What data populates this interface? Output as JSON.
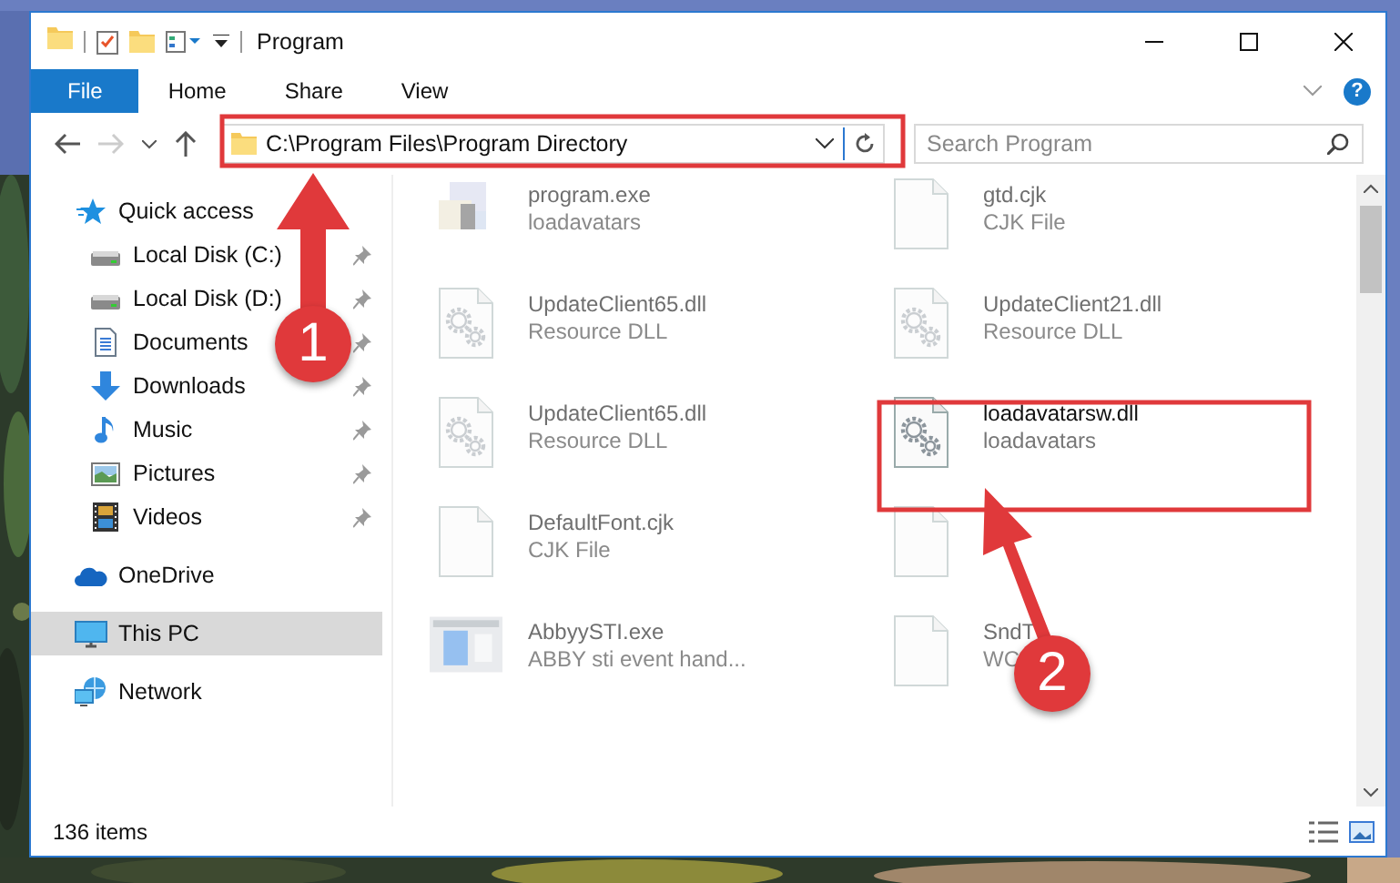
{
  "window": {
    "title": "Program"
  },
  "ribbon_tabs": [
    {
      "label": "File",
      "kind": "file"
    },
    {
      "label": "Home",
      "kind": "tab"
    },
    {
      "label": "Share",
      "kind": "tab"
    },
    {
      "label": "View",
      "kind": "tab"
    }
  ],
  "help": "?",
  "address": {
    "path": "C:\\Program Files\\Program Directory"
  },
  "search": {
    "placeholder": "Search Program"
  },
  "nav": [
    {
      "label": "Quick access",
      "kind": "star",
      "selected": false,
      "children": [
        {
          "label": "Local Disk (C:)",
          "kind": "drive",
          "pinned": true,
          "selected": false
        },
        {
          "label": "Local Disk (D:)",
          "kind": "drive",
          "pinned": true,
          "selected": false
        },
        {
          "label": "Documents",
          "kind": "documents",
          "pinned": true,
          "selected": false
        },
        {
          "label": "Downloads",
          "kind": "downloads",
          "pinned": true,
          "selected": false
        },
        {
          "label": "Music",
          "kind": "music",
          "pinned": true,
          "selected": false
        },
        {
          "label": "Pictures",
          "kind": "pictures",
          "pinned": true,
          "selected": false
        },
        {
          "label": "Videos",
          "kind": "videos",
          "pinned": true,
          "selected": false
        }
      ]
    },
    {
      "label": "OneDrive",
      "kind": "cloud",
      "selected": false
    },
    {
      "label": "This PC",
      "kind": "pc",
      "selected": true
    },
    {
      "label": "Network",
      "kind": "network",
      "selected": false
    }
  ],
  "files": [
    {
      "name": "program.exe",
      "type": "loadavatars",
      "kind": "exe",
      "blurred": true
    },
    {
      "name": "gtd.cjk",
      "type": "CJK File",
      "kind": "file",
      "blurred": true
    },
    {
      "name": "UpdateClient65.dll",
      "type": "Resource DLL",
      "kind": "dll",
      "blurred": true
    },
    {
      "name": "UpdateClient21.dll",
      "type": "Resource DLL",
      "kind": "dll",
      "blurred": true
    },
    {
      "name": "UpdateClient65.dll",
      "type": "Resource DLL",
      "kind": "dll",
      "blurred": true
    },
    {
      "name": "loadavatarsw.dll",
      "type": "loadavatars",
      "kind": "dll",
      "blurred": false
    },
    {
      "name": "DefaultFont.cjk",
      "type": "CJK File",
      "kind": "file",
      "blurred": true
    },
    {
      "kind": "file",
      "blurred": true
    },
    {
      "name": "AbbyySTI.exe",
      "type": "ABBY sti event hand...",
      "kind": "app",
      "blurred": true
    },
    {
      "name": "SndT",
      "type": "WC",
      "kind": "file",
      "blurred": true
    }
  ],
  "status_bar": {
    "count": "136 items"
  },
  "callouts": [
    {
      "number": "1"
    },
    {
      "number": "2"
    }
  ]
}
